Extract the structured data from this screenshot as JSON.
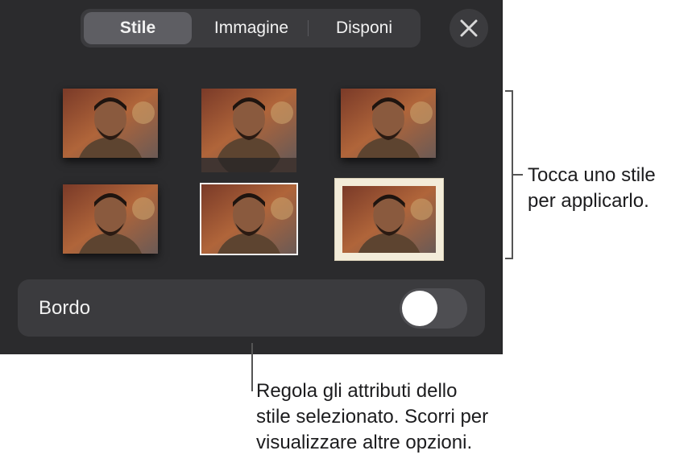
{
  "tabs": [
    {
      "label": "Stile",
      "selected": true
    },
    {
      "label": "Immagine",
      "selected": false
    },
    {
      "label": "Disponi",
      "selected": false
    }
  ],
  "close_icon": "close-icon",
  "styles": [
    {
      "name": "shadow"
    },
    {
      "name": "reflection"
    },
    {
      "name": "shadow-large"
    },
    {
      "name": "plain"
    },
    {
      "name": "thin-white-border"
    },
    {
      "name": "cream-frame"
    }
  ],
  "border": {
    "label": "Bordo",
    "enabled": false
  },
  "callouts": {
    "styles_line1": "Tocca uno stile",
    "styles_line2": "per applicarlo.",
    "border_line1": "Regola gli attributi dello",
    "border_line2": "stile selezionato. Scorri per",
    "border_line3": "visualizzare altre opzioni."
  },
  "colors": {
    "panel": "#2b2b2d",
    "control": "#3b3b3e",
    "selected_segment": "#5e5e63",
    "frame": "#f3ecd9"
  }
}
